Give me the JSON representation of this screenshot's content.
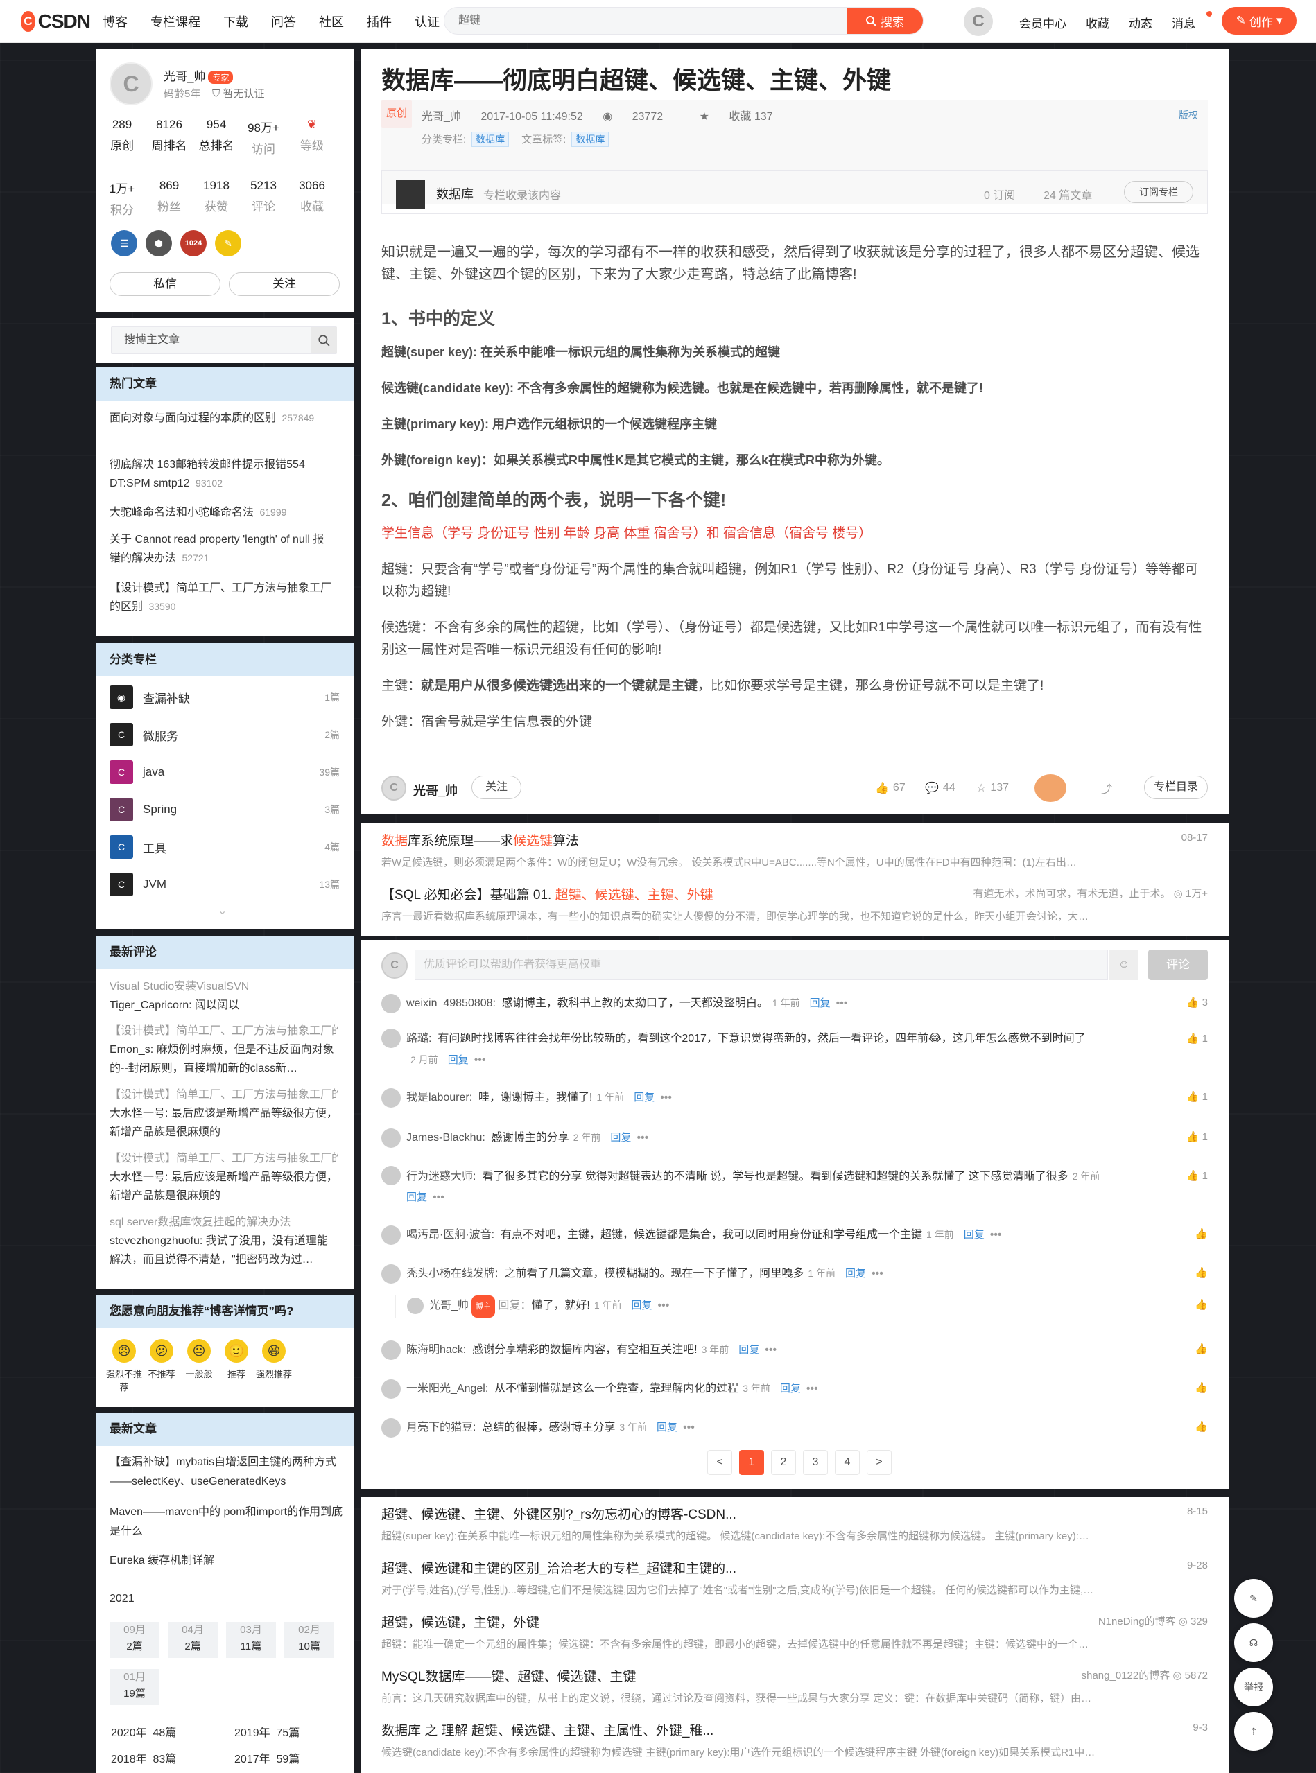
{
  "topbar": {
    "logo": "CSDN",
    "nav": [
      "博客",
      "专栏课程",
      "下载",
      "问答",
      "社区",
      "插件",
      "认证"
    ],
    "search_placeholder": "超键",
    "search_btn": "搜索",
    "links": [
      "会员中心",
      "收藏",
      "动态",
      "消息"
    ],
    "create": "创作"
  },
  "profile": {
    "name": "光哥_帅",
    "badge": "专家",
    "code_age": "码龄5年",
    "auth": "暂无认证",
    "stats1": [
      {
        "v": "289",
        "l": "原创"
      },
      {
        "v": "8126",
        "l": "周排名"
      },
      {
        "v": "954",
        "l": "总排名"
      },
      {
        "v": "98万+",
        "l": "访问"
      },
      {
        "v": "",
        "l": "等级"
      }
    ],
    "stats2": [
      {
        "v": "1万+",
        "l": "积分"
      },
      {
        "v": "869",
        "l": "粉丝"
      },
      {
        "v": "1918",
        "l": "获赞"
      },
      {
        "v": "5213",
        "l": "评论"
      },
      {
        "v": "3066",
        "l": "收藏"
      }
    ],
    "medal_1024": "1024",
    "msg_btn": "私信",
    "follow_btn": "关注"
  },
  "side_search": {
    "placeholder": "搜博主文章"
  },
  "hot": {
    "title": "热门文章",
    "items": [
      {
        "t": "面向对象与面向过程的本质的区别",
        "v": "257849"
      },
      {
        "t": "彻底解决 163邮箱转发邮件提示报错554 DT:SPM smtp12",
        "v": "93102"
      },
      {
        "t": "大驼峰命名法和小驼峰命名法",
        "v": "61999"
      },
      {
        "t": "关于 Cannot read property 'length' of null 报错的解决办法",
        "v": "52721"
      },
      {
        "t": "【设计模式】简单工厂、工厂方法与抽象工厂的区别",
        "v": "33590"
      }
    ]
  },
  "columns": {
    "title": "分类专栏",
    "items": [
      {
        "n": "查漏补缺",
        "c": "1篇"
      },
      {
        "n": "微服务",
        "c": "2篇"
      },
      {
        "n": "java",
        "c": "39篇"
      },
      {
        "n": "Spring",
        "c": "3篇"
      },
      {
        "n": "工具",
        "c": "4篇"
      },
      {
        "n": "JVM",
        "c": "13篇"
      }
    ]
  },
  "latest_comments": {
    "title": "最新评论",
    "items": [
      {
        "t": "Visual Studio安装VisualSVN",
        "b": "Tiger_Capricorn: 阔以阔以"
      },
      {
        "t": "【设计模式】简单工厂、工厂方法与抽象工厂的区别",
        "b": "Emon_s: 麻烦例时麻烦，但是不违反面向对象的--封闭原则，直接增加新的class新…"
      },
      {
        "t": "【设计模式】简单工厂、工厂方法与抽象工厂的区别",
        "b": "大水怪一号: 最后应该是新增产品等级很方便，新增产品族是很麻烦的"
      },
      {
        "t": "【设计模式】简单工厂、工厂方法与抽象工厂的区别",
        "b": "大水怪一号: 最后应该是新增产品等级很方便，新增产品族是很麻烦的"
      },
      {
        "t": "sql server数据库恢复挂起的解决办法",
        "b": "stevezhongzhuofu: 我试了没用，没有道理能解决，而且说得不清楚，\"把密码改为过…"
      }
    ]
  },
  "recommend": {
    "title": "您愿意向朋友推荐“博客详情页”吗?",
    "faces": [
      "强烈不推荐",
      "不推荐",
      "一般般",
      "推荐",
      "强烈推荐"
    ]
  },
  "newest": {
    "title": "最新文章",
    "items": [
      "【查漏补缺】mybatis自增返回主键的两种方式——selectKey、useGeneratedKeys",
      "Maven——maven中的 pom和import的作用到底是什么",
      "Eureka 缓存机制详解"
    ],
    "year": "2021",
    "months": [
      {
        "m": "09月",
        "c": "2篇"
      },
      {
        "m": "04月",
        "c": "2篇"
      },
      {
        "m": "03月",
        "c": "11篇"
      },
      {
        "m": "02月",
        "c": "10篇"
      },
      {
        "m": "01月",
        "c": "19篇"
      }
    ],
    "years": [
      {
        "y": "2020年",
        "c": "48篇"
      },
      {
        "y": "2019年",
        "c": "75篇"
      },
      {
        "y": "2018年",
        "c": "83篇"
      },
      {
        "y": "2017年",
        "c": "59篇"
      }
    ]
  },
  "article": {
    "title": "数据库——彻底明白超键、候选键、主键、外键",
    "orig": "原创",
    "author": "光哥_帅",
    "date": "2017-10-05 11:49:52",
    "views": "23772",
    "fav": "收藏 137",
    "copyright": "版权",
    "col_label": "分类专栏:",
    "col_tag": "数据库",
    "tag_label": "文章标签:",
    "tag": "数据库",
    "colbox": {
      "name": "数据库",
      "desc": "专栏收录该内容",
      "subs": "0 订阅",
      "count": "24 篇文章",
      "btn": "订阅专栏"
    },
    "intro": "知识就是一遍又一遍的学，每次的学习都有不一样的收获和感受，然后得到了收获就该是分享的过程了，很多人都不易区分超键、候选键、主键、外键这四个键的区别，下来为了大家少走弯路，特总结了此篇博客!",
    "h1": "1、书中的定义",
    "d1": "超键(super key): 在关系中能唯一标识元组的属性集称为关系模式的超键",
    "d2": "候选键(candidate key): 不含有多余属性的超键称为候选键。也就是在候选键中，若再删除属性，就不是键了!",
    "d3": "主键(primary key): 用户选作元组标识的一个候选键程序主键",
    "d4": "外键(foreign key)：如果关系模式R中属性K是其它模式的主键，那么k在模式R中称为外键。",
    "h2": "2、咱们创建简单的两个表，说明一下各个键!",
    "s1a": "学生信息",
    "s1b": "（学号 身份证号 性别 年龄 身高 体重 宿舍号）和 宿舍信息（宿舍号 楼号）",
    "s2": "超键：只要含有“学号”或者“身份证号”两个属性的集合就叫超键，例如R1（学号 性别）、R2（身份证号 身高）、R3（学号 身份证号）等等都可以称为超键!",
    "s3": "候选键：不含有多余的属性的超键，比如（学号）、（身份证号）都是候选键，又比如R1中学号这一个属性就可以唯一标识元组了，而有没有性别这一属性对是否唯一标识元组没有任何的影响!",
    "s4a": "主键：",
    "s4b": "就是用户从很多候选键选出来的一个键就是主键",
    "s4c": "，比如你要求学号是主键，那么身份证号就不可以是主键了!",
    "s5": "外键：宿舍号就是学生信息表的外键",
    "toolbar": {
      "author": "光哥_帅",
      "follow": "关注",
      "likes": "67",
      "comments": "44",
      "favs": "137",
      "dir": "专栏目录"
    }
  },
  "related1": [
    {
      "t1": "数据",
      "t2": "库系统原理——求",
      "t3": "候选键",
      "t4": "算法",
      "r": "08-17",
      "d": "若W是候选键，则必须满足两个条件：W的闭包是U；W没有冗余。 设关系模式R中U=ABC.......等N个属性，U中的属性在FD中有四种范围：(1)左右出…"
    },
    {
      "t1": "",
      "t2": "【SQL 必知必会】基础篇 01. ",
      "t3": "超键、候选键、主键、外键",
      "t4": "",
      "r": "有道无术，术尚可求，有术无道，止于术。 ◎ 1万+",
      "d": "序言一最近看数据库系统原理课本，有一些小的知识点看的确实让人傻傻的分不清，即使学心理学的我，也不知道它说的是什么，昨天小组开会讨论，大…"
    }
  ],
  "comments": {
    "placeholder": "优质评论可以帮助作者获得更高权重",
    "btn": "评论",
    "items": [
      {
        "u": "weixin_49850808:",
        "c": "感谢博主，教科书上教的太拗口了，一天都没整明白。",
        "tm": "1 年前",
        "lk": "3"
      },
      {
        "u": "路璐:",
        "c": "有问题时找博客往往会找年份比较新的，看到这个2017，下意识觉得蛮新的，然后一看评论，四年前😂，这几年怎么感觉不到时间了",
        "tm": "2 月前",
        "lk": "1"
      },
      {
        "u": "我是labourer:",
        "c": "哇，谢谢博主，我懂了!",
        "tm": "1 年前",
        "lk": "1"
      },
      {
        "u": "James-Blackhu:",
        "c": "感谢博主的分享",
        "tm": "2 年前",
        "lk": "1"
      },
      {
        "u": "行为迷惑大师:",
        "c": "看了很多其它的分享 觉得对超键表达的不清晰 说，学号也是超键。看到候选键和超键的关系就懂了 这下感觉清晰了很多",
        "tm": "2 年前",
        "lk": "1"
      },
      {
        "u": "喝汚昂·医舸·波音:",
        "c": "有点不对吧，主键，超键，候选键都是集合，我可以同时用身份证和学号组成一个主键",
        "tm": "1 年前",
        "lk": ""
      },
      {
        "u": "秃头小杨在线发牌:",
        "c": "之前看了几篇文章，模模糊糊的。现在一下子懂了，阿里嘎多",
        "tm": "1 年前",
        "lk": ""
      },
      {
        "u": "陈海明hack:",
        "c": "感谢分享精彩的数据库内容，有空相互关注吧!",
        "tm": "3 年前",
        "lk": ""
      },
      {
        "u": "一米阳光_Angel:",
        "c": "从不懂到懂就是这么一个靠查，靠理解内化的过程",
        "tm": "3 年前",
        "lk": ""
      },
      {
        "u": "月亮下的猫豆:",
        "c": "总结的很棒，感谢博主分享",
        "tm": "3 年前",
        "lk": ""
      }
    ],
    "reply": {
      "u": "光哥_帅",
      "tag": "博主",
      "r": "回复：",
      "c": "懂了，就好!",
      "tm": "1 年前"
    },
    "reply_label": "回复",
    "pages": [
      "<",
      "1",
      "2",
      "3",
      "4",
      ">"
    ]
  },
  "related2": [
    {
      "t": "超键、候选键、主键、外键区别?_rs勿忘初心的博客-CSDN...",
      "r": "8-15",
      "d": "超键(super key):在关系中能唯一标识元组的属性集称为关系模式的超键。 候选键(candidate key):不含有多余属性的超键称为候选键。 主键(primary key):…"
    },
    {
      "t": "超键、候选键和主键的区别_洽洽老大的专栏_超键和主键的...",
      "r": "9-28",
      "d": "对于(学号,姓名),(学号,性别)...等超键,它们不是候选键,因为它们去掉了\"姓名\"或者\"性别\"之后,变成的(学号)依旧是一个超键。 任何的候选键都可以作为主键,…"
    },
    {
      "t": "超键，候选键，主键，外键",
      "r": "N1neDing的博客 ◎ 329",
      "d": "超键：能唯一确定一个元组的属性集；候选键：不含有多余属性的超键，即最小的超键，去掉候选键中的任意属性就不再是超键；主键：候选键中的一个…"
    },
    {
      "t": "MySQL数据库——键、超键、候选键、主键",
      "r": "shang_0122的博客 ◎ 5872",
      "d": "前言：这几天研究数据库中的键，从书上的定义说，很绕，通过讨论及查阅资料，获得一些成果与大家分享 定义：键：在数据库中关键码（简称，键）由…"
    },
    {
      "t": "数据库 之 理解 超键、候选键、主键、主属性、外键_稚...",
      "r": "9-3",
      "d": "候选键(candidate key):不含有多余属性的超键称为候选键 主键(primary key):用户选作元组标识的一个候选键程序主键 外键(foreign key)如果关系模式R1中…"
    }
  ],
  "fab": {
    "report": "举报"
  },
  "colors": {
    "brand": "#fc5531",
    "link": "#3a8bd6",
    "panel": "#d7e9f7"
  }
}
